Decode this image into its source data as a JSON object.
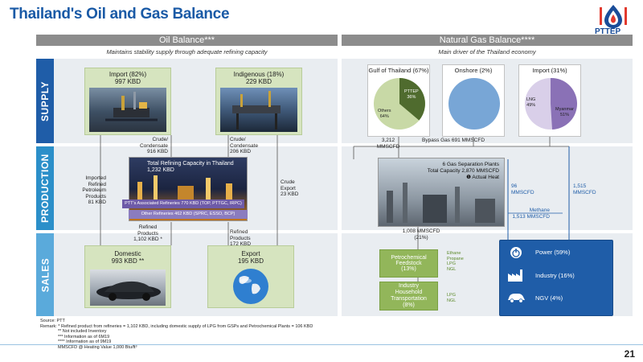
{
  "page": {
    "title": "Thailand's Oil and Gas Balance",
    "logo_text": "PTTEP",
    "page_number": "21"
  },
  "oil": {
    "header": "Oil Balance***",
    "subtitle": "Maintains stability supply through adequate refining capacity",
    "supply_label": "SUPPLY",
    "production_label": "PRODUCTION",
    "sales_label": "SALES",
    "import_title": "Import (82%)",
    "import_value": "997 KBD",
    "indigenous_title": "Indigenous (18%)",
    "indigenous_value": "229 KBD",
    "crude_left_1": "Crude/",
    "crude_left_2": "Condensate",
    "crude_left_3": "916 KBD",
    "crude_right_1": "Crude/",
    "crude_right_2": "Condensate",
    "crude_right_3": "206 KBD",
    "refining_title": "Total Refining Capacity in Thailand",
    "refining_value": "1,232 KBD",
    "ptt_refineries": "PTT's Associated Refineries 770 KBD (TOP, PTTGC, IRPC)",
    "other_refineries": "Other Refineries 462 KBD (SPRC, ESSO, BCP)",
    "imported_1": "Imported",
    "imported_2": "Refined",
    "imported_3": "Petroleum",
    "imported_4": "Products",
    "imported_5": "81 KBD",
    "crude_export_1": "Crude",
    "crude_export_2": "Export",
    "crude_export_3": "23 KBD",
    "refined_left_1": "Refined",
    "refined_left_2": "Products",
    "refined_left_3": "1,102 KBD *",
    "refined_right_1": "Refined",
    "refined_right_2": "Products",
    "refined_right_3": "172 KBD",
    "domestic_title": "Domestic",
    "domestic_value": "993 KBD **",
    "export_title": "Export",
    "export_value": "195 KBD"
  },
  "gas": {
    "header": "Natural Gas Balance****",
    "subtitle": "Main driver of the Thailand economy",
    "gulf_title": "Gulf of Thailand (67%)",
    "gulf_pttep": "PTTEP",
    "gulf_pttep_pct": "36%",
    "gulf_others": "Others",
    "gulf_others_pct": "64%",
    "onshore_title": "Onshore (2%)",
    "import_title": "Import (31%)",
    "import_lng": "LNG",
    "import_lng_pct": "49%",
    "import_myanmar": "Myanmar",
    "import_myanmar_pct": "51%",
    "flow_3212_1": "3,212",
    "flow_3212_2": "MMSCFD",
    "bypass": "Bypass Gas 691 MMSCFD",
    "gsp_title_1": "6 Gas Separation Plants",
    "gsp_title_2": "Total Capacity 2,870 MMSCFD",
    "gsp_actual": "❶ Actual Heat",
    "flow_96_1": "96",
    "flow_96_2": "MMSCFD",
    "flow_1515_1": "1,515",
    "flow_1515_2": "MMSCFD",
    "methane_1": "Methane",
    "methane_2": "1,513 MMSCFD",
    "flow_1008_1": "1,008 MMSCFD",
    "flow_1008_2": "(21%)",
    "petro_1": "Petrochemical",
    "petro_2": "Feedstock",
    "petro_3": "(13%)",
    "petro_products_1": "Ethane",
    "petro_products_2": "Propane",
    "petro_products_3": "LPG",
    "petro_products_4": "NGL",
    "industry_1": "Industry",
    "industry_2": "Household",
    "industry_3": "Transportation",
    "industry_4": "(8%)",
    "industry_products_1": "LPG",
    "industry_products_2": "NGL",
    "power": "Power (59%)",
    "industry": "Industry (16%)",
    "ngv": "NGV (4%)"
  },
  "footnotes": {
    "source": "Source: PTT",
    "remark": "Remark: *    Refined product from refineries = 1,102 KBD, including domestic supply of LPG from GSPs and Petrochemical Plants = 106 KBD",
    "n2": "**   Not included Inventory",
    "n3": "***  Information as of 6M19",
    "n4": "**** Information as of 9M19",
    "n5": "MMSCFD @ Heating Value 1,000 Btu/ft³"
  },
  "colors": {
    "title_blue": "#1a5aa6",
    "header_gray": "#8c8c8c",
    "supply_blue": "#1f5da8",
    "production_blue": "#2b8fc9",
    "sales_blue": "#5aaadb",
    "oil_green": "#d6e4bf",
    "pie_green": "#4f6b2e",
    "pie_light_green": "#c8d9a6",
    "pie_blue": "#78a6d6",
    "pie_purple": "#8a71b6",
    "pie_lavender": "#d9cfe9",
    "sales_panel_blue": "#1f5da8"
  }
}
